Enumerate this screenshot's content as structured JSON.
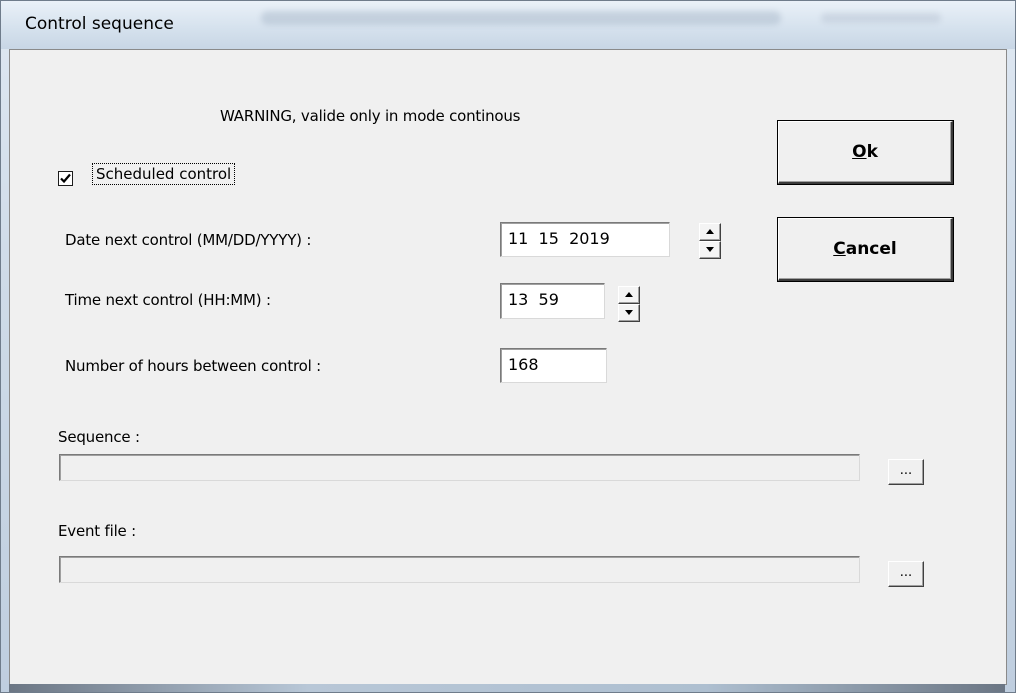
{
  "window": {
    "title": "Control sequence"
  },
  "warning_text": "WARNING, valide only in mode continous",
  "scheduled": {
    "label": "Scheduled  control",
    "checked": true
  },
  "date_next": {
    "label": "Date next control (MM/DD/YYYY) :",
    "value": "11  15  2019"
  },
  "time_next": {
    "label": "Time next control (HH:MM) :",
    "value": "13  59"
  },
  "hours_between": {
    "label": "Number of hours between control :",
    "value": "168"
  },
  "sequence": {
    "label": "Sequence :",
    "value": "",
    "browse_label": "..."
  },
  "event_file": {
    "label": "Event file :",
    "value": "",
    "browse_label": "..."
  },
  "buttons": {
    "ok": {
      "mnemonic": "O",
      "rest": "k"
    },
    "cancel": {
      "mnemonic": "C",
      "rest": "ancel"
    }
  },
  "colors": {
    "client_bg": "#f0f0f0",
    "titlebar": "#dfe8f2"
  }
}
